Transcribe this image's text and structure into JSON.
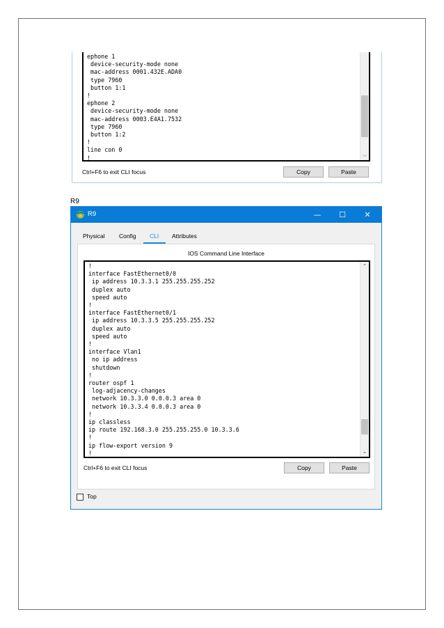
{
  "top_panel": {
    "cli_lines": [
      "ephone 1",
      " device-security-mode none",
      " mac-address 0001.432E.ADA0",
      " type 7960",
      " button 1:1",
      "!",
      "ephone 2",
      " device-security-mode none",
      " mac-address 0003.E4A1.7532",
      " type 7960",
      " button 1:2",
      "!",
      "line con 0",
      "!"
    ],
    "hint": "Ctrl+F6 to exit CLI focus",
    "copy_label": "Copy",
    "paste_label": "Paste",
    "scroll_down_icon": "chevron-down-icon"
  },
  "caption": "R9",
  "window": {
    "title": "R9",
    "app_icon": "packet-tracer-icon",
    "minimize_glyph": "—",
    "maximize_glyph": "☐",
    "close_glyph": "✕",
    "tabs": [
      {
        "label": "Physical",
        "active": false
      },
      {
        "label": "Config",
        "active": false
      },
      {
        "label": "CLI",
        "active": true
      },
      {
        "label": "Attributes",
        "active": false
      }
    ],
    "panel_title": "IOS Command Line Interface",
    "cli_lines": [
      "!",
      "interface FastEthernet0/0",
      " ip address 10.3.3.1 255.255.255.252",
      " duplex auto",
      " speed auto",
      "!",
      "interface FastEthernet0/1",
      " ip address 10.3.3.5 255.255.255.252",
      " duplex auto",
      " speed auto",
      "!",
      "interface Vlan1",
      " no ip address",
      " shutdown",
      "!",
      "router ospf 1",
      " log-adjacency-changes",
      " network 10.3.3.0 0.0.0.3 area 0",
      " network 10.3.3.4 0.0.0.3 area 0",
      "!",
      "ip classless",
      "ip route 192.168.3.0 255.255.255.0 10.3.3.6",
      "!",
      "ip flow-export version 9",
      "!"
    ],
    "hint": "Ctrl+F6 to exit CLI focus",
    "copy_label": "Copy",
    "paste_label": "Paste",
    "top_checkbox_label": "Top",
    "top_checked": false
  }
}
